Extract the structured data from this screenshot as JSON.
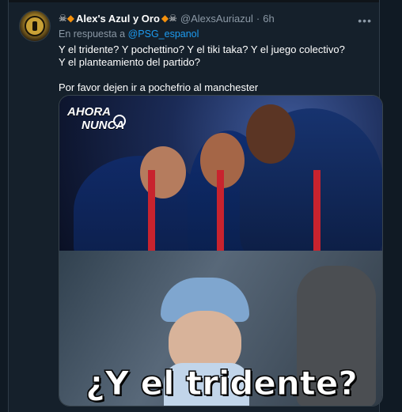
{
  "tweet": {
    "author": {
      "name_prefix": "☠️🔶",
      "name": "Alex's Azul y Oro",
      "name_suffix": "🔶☠️",
      "handle": "@AlexsAuriazul",
      "separator": "·",
      "time": "6h"
    },
    "reply": {
      "prefix": "En respuesta a",
      "handle": "@PSG_espanol"
    },
    "text": {
      "line1": "Y el tridente? Y pochettino? Y el tiki taka? Y el juego colectivo?",
      "line2": "Y el planteamiento del partido?",
      "line3": "Por favor dejen ir a pochefrio al manchester"
    },
    "media": {
      "logo_line1": "AHORA",
      "logo_line2": "NUNCA",
      "caption": "¿Y el tridente?"
    },
    "icons": {
      "more": "more-icon",
      "skull": "skull-icon",
      "diamond": "orange-diamond-icon"
    }
  },
  "colors": {
    "background": "#15202b",
    "text": "#ffffff",
    "muted": "#8b98a5",
    "link": "#1d9bf0",
    "border": "#38444d"
  }
}
